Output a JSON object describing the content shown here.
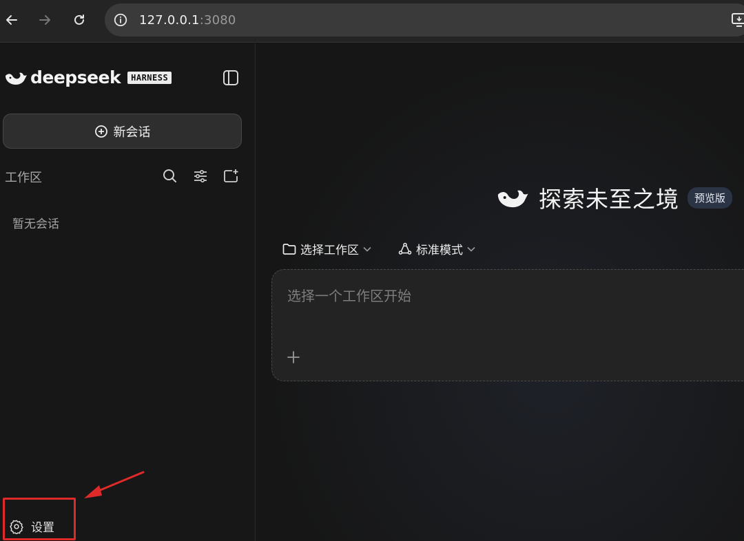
{
  "browser": {
    "url_host": "127.0.0.1",
    "url_port": ":3080"
  },
  "sidebar": {
    "logo_text": "deepseek",
    "logo_badge": "HARNESS",
    "new_chat_label": "新会话",
    "workspace_label": "工作区",
    "empty_message": "暂无会话",
    "settings_label": "设置"
  },
  "main": {
    "title": "探索未至之境",
    "badge": "预览版",
    "workspace_selector": "选择工作区",
    "mode_selector": "标准模式",
    "composer_placeholder": "选择一个工作区开始"
  },
  "colors": {
    "highlight_box": "#e02a2a",
    "badge_bg": "#2b3445"
  }
}
